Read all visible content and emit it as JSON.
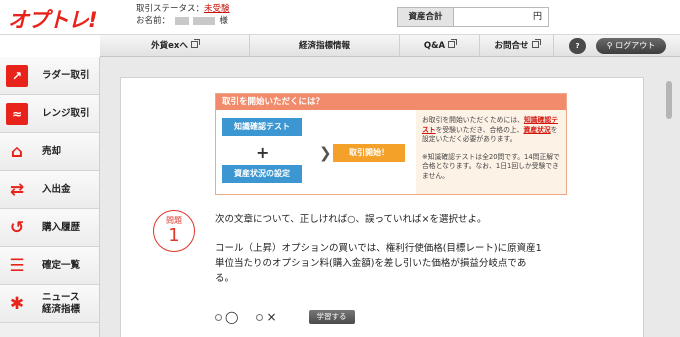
{
  "header": {
    "logo_main": "オプト",
    "logo_tail": "レ!",
    "status_label": "取引ステータス：",
    "status_value": "未受験",
    "name_label": "お名前：",
    "name_suffix": "様",
    "assets_label": "資産合計",
    "assets_value": "円"
  },
  "nav": {
    "items": [
      {
        "label": "外貨exへ"
      },
      {
        "label": "経済指標情報"
      },
      {
        "label": "Q&A"
      },
      {
        "label": "お問合せ"
      }
    ],
    "help_label": "ヘルプ",
    "logout_label": "ログアウト"
  },
  "sidebar": {
    "items": [
      {
        "label": "ラダー取引",
        "icon": "ladder-chart-icon"
      },
      {
        "label": "レンジ取引",
        "icon": "range-chart-icon"
      },
      {
        "label": "売却",
        "icon": "sell-icon"
      },
      {
        "label": "入出金",
        "icon": "transfer-arrows-icon"
      },
      {
        "label": "購入履歴",
        "icon": "history-icon"
      },
      {
        "label": "確定一覧",
        "icon": "list-icon"
      },
      {
        "label": "ニュース",
        "label2": "経済指標",
        "icon": "news-icon"
      }
    ]
  },
  "info": {
    "title": "取引を開始いただくには？",
    "btn_test": "知識確認テスト",
    "btn_assets": "資産状況の設定",
    "plus": "+",
    "chevron": "❯",
    "btn_start": "取引開始！",
    "right_p1a": "お取引を開始いただくためには、",
    "right_p1b": "知識確認テスト",
    "right_p1c": "を受験いただき、合格の上、",
    "right_p1d": "資産状況",
    "right_p1e": "を設定いただく必要があります。",
    "right_p2": "※知識確認テストは全20問です。14問正解で合格となります。なお、1日1回しか受験できません。"
  },
  "question": {
    "badge_label": "問題",
    "badge_number": "1",
    "prompt": "次の文章について、正しければ○、誤っていれば×を選択せよ。",
    "body": "コール（上昇）オプションの買いでは、権利行使価格(目標レート)に原資産1単位当たりのオプション料(購入金額)を差し引いた価格が損益分岐点である。",
    "option_true": "◯",
    "option_false": "×",
    "study_label": "学習する"
  }
}
